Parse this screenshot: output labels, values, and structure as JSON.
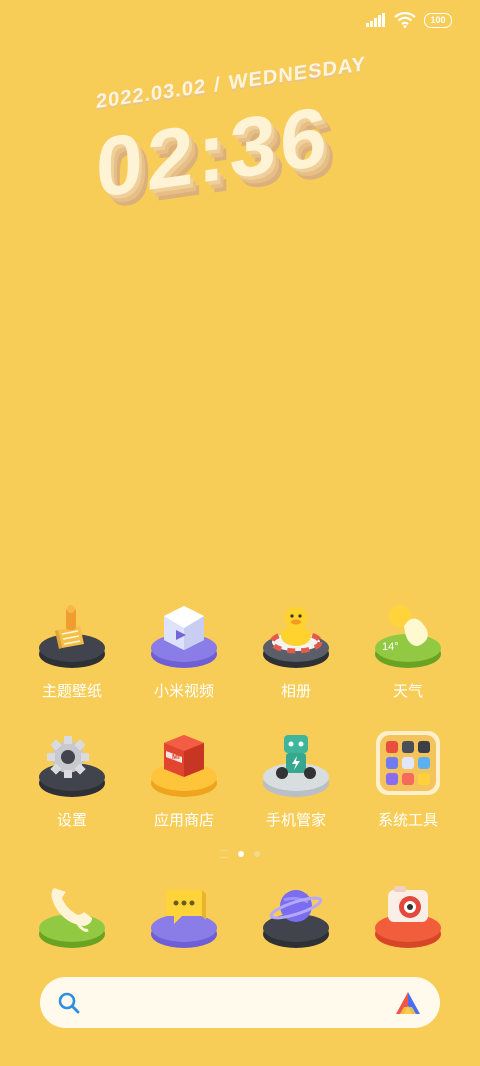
{
  "status": {
    "battery": "100"
  },
  "clock": {
    "date": "2022.03.02",
    "weekday": "WEDNESDAY",
    "time": "02:36"
  },
  "apps": [
    {
      "label": "主题壁纸",
      "icon": "theme-wallpaper-icon"
    },
    {
      "label": "小米视频",
      "icon": "video-icon"
    },
    {
      "label": "相册",
      "icon": "gallery-duck-icon"
    },
    {
      "label": "天气",
      "icon": "weather-icon",
      "badge": "14°"
    },
    {
      "label": "设置",
      "icon": "settings-gear-icon"
    },
    {
      "label": "应用商店",
      "icon": "app-store-icon",
      "badge": "MI"
    },
    {
      "label": "手机管家",
      "icon": "security-robot-icon"
    },
    {
      "label": "系统工具",
      "icon": "system-tools-folder-icon"
    }
  ],
  "dock": [
    {
      "icon": "phone-icon"
    },
    {
      "icon": "messages-icon"
    },
    {
      "icon": "browser-planet-icon"
    },
    {
      "icon": "camera-icon"
    }
  ],
  "pages": {
    "count": 2,
    "current": 1
  },
  "search": {
    "left_icon": "search-icon",
    "right_icon": "assistant-logo-icon"
  }
}
